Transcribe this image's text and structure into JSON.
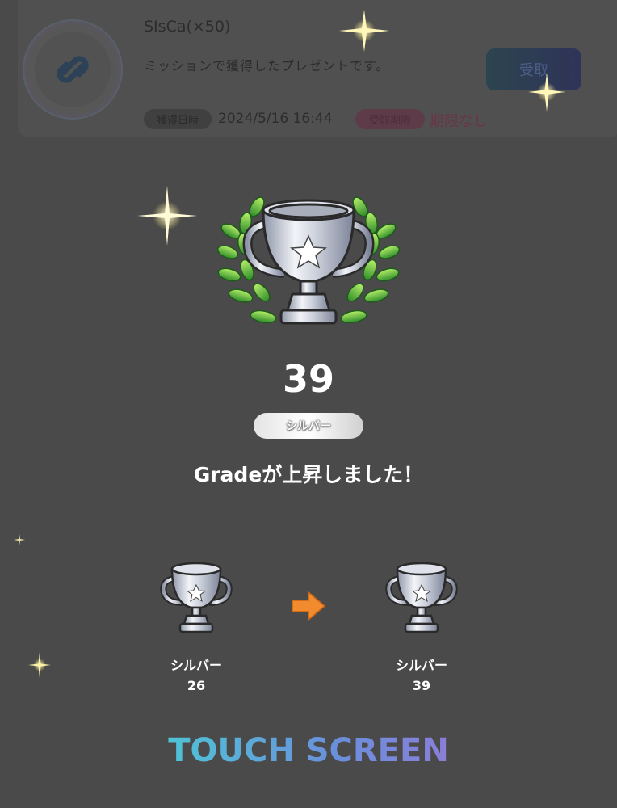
{
  "present": {
    "title": "SIsCa(×50)",
    "description": "ミッションで獲得したプレゼントです。",
    "receive_label": "受取",
    "acquired_label": "獲得日時",
    "acquired_value": "2024/5/16 16:44",
    "deadline_label": "受取期限",
    "deadline_value": "期限なし"
  },
  "result": {
    "grade_value": "39",
    "rank_name": "シルバー",
    "message": "Gradeが上昇しました！"
  },
  "comparison": {
    "before_rank": "シルバー",
    "before_value": "26",
    "after_rank": "シルバー",
    "after_value": "39"
  },
  "footer": {
    "touch_label": "TOUCH SCREEN"
  },
  "colors": {
    "background": "#4a4a4a",
    "arrow": "#f28a2e",
    "touch_gradient_start": "#4fc3d6",
    "touch_gradient_end": "#8a7fd8"
  }
}
